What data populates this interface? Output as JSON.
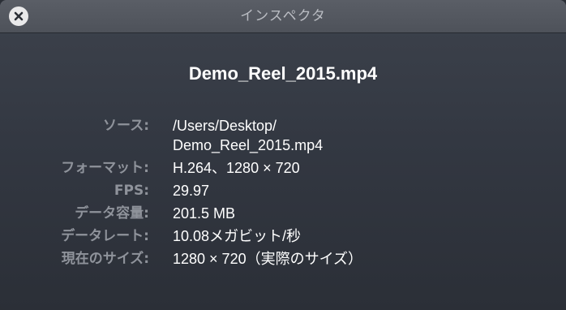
{
  "window": {
    "title": "インスペクタ"
  },
  "file": {
    "name": "Demo_Reel_2015.mp4"
  },
  "info": [
    {
      "label": "ソース:",
      "lines": [
        "/Users/Desktop/",
        "Demo_Reel_2015.mp4"
      ]
    },
    {
      "label": "フォーマット:",
      "lines": [
        "H.264、1280 × 720"
      ]
    },
    {
      "label": "FPS:",
      "lines": [
        "29.97"
      ]
    },
    {
      "label": "データ容量:",
      "lines": [
        "201.5 MB"
      ]
    },
    {
      "label": "データレート:",
      "lines": [
        "10.08メガビット/秒"
      ]
    },
    {
      "label": "現在のサイズ:",
      "lines": [
        "1280 × 720（実際のサイズ）"
      ]
    }
  ],
  "icons": {
    "close": "close-icon"
  },
  "colors": {
    "title_text": "#b9bcc2",
    "label_text": "#8f939b",
    "value_text": "#ffffff",
    "close_button": "#e9e9ea"
  }
}
